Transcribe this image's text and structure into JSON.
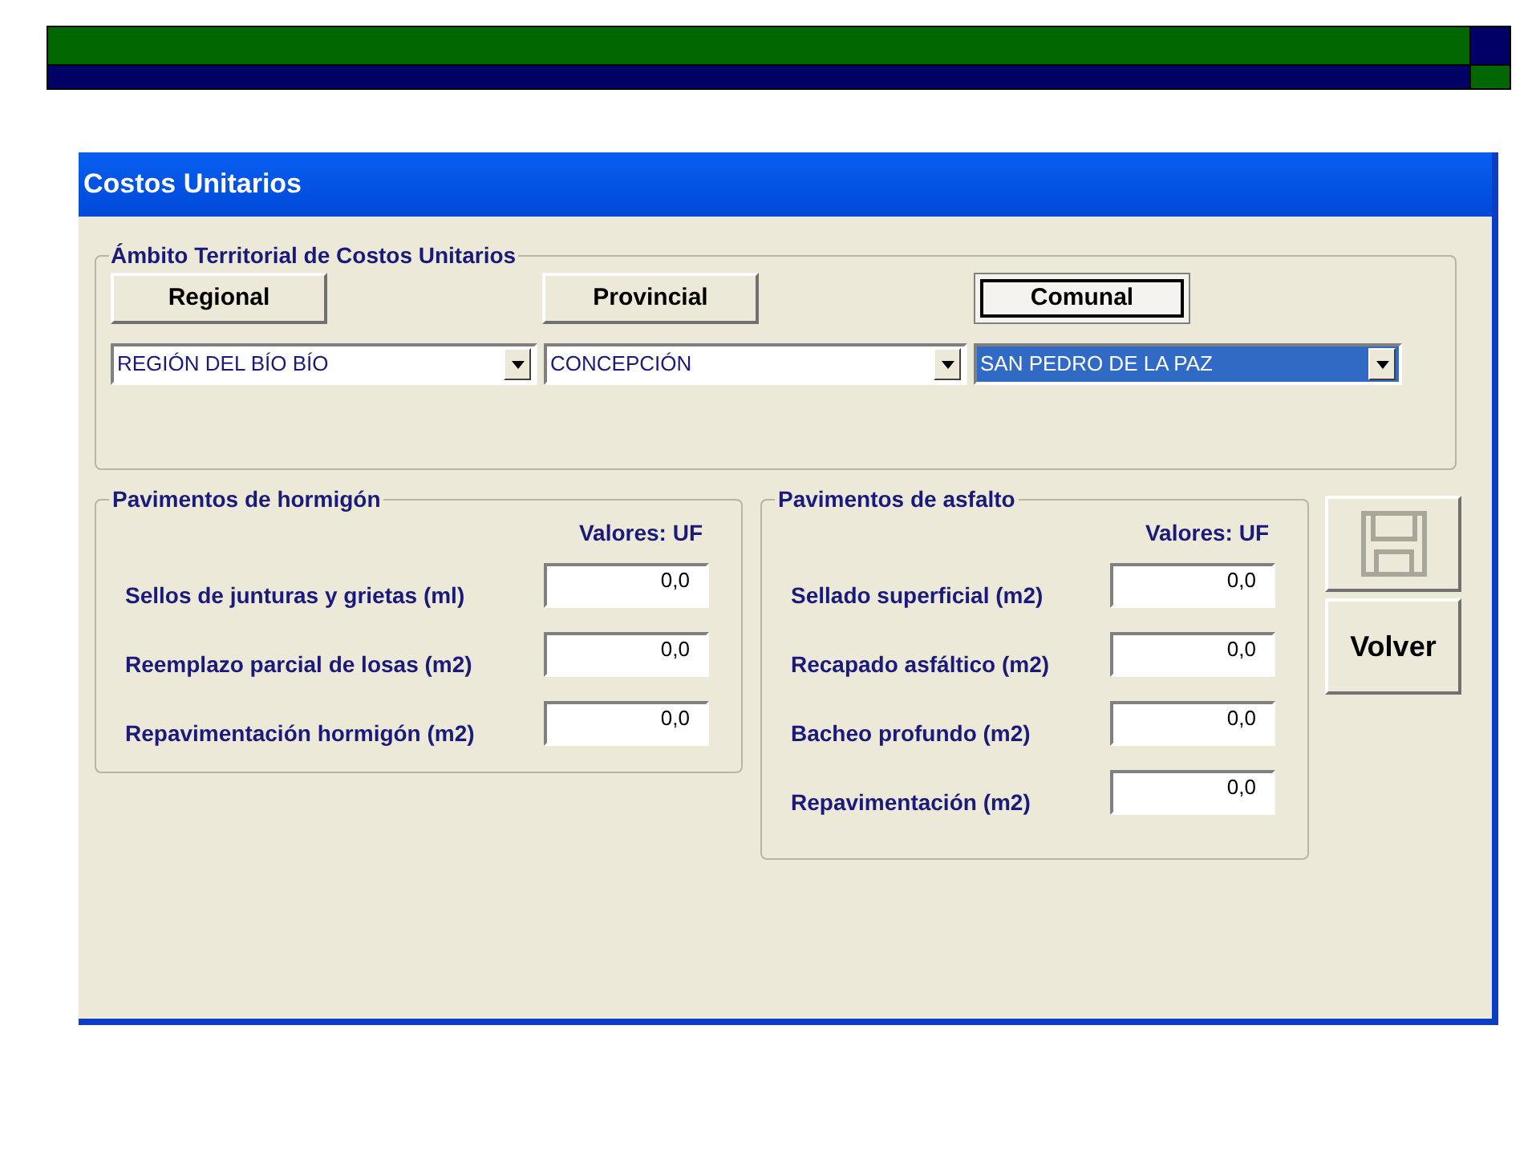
{
  "window": {
    "title": "Costos Unitarios"
  },
  "scope": {
    "legend": "Ámbito Territorial de Costos Unitarios",
    "buttons": [
      {
        "label": "Regional",
        "selected": false
      },
      {
        "label": "Provincial",
        "selected": false
      },
      {
        "label": "Comunal",
        "selected": true
      }
    ],
    "dropdowns": [
      {
        "value": "REGIÓN DEL BÍO BÍO",
        "focused": false
      },
      {
        "value": "CONCEPCIÓN",
        "focused": false
      },
      {
        "value": "SAN PEDRO DE LA PAZ",
        "focused": true
      }
    ]
  },
  "groups": [
    {
      "legend": "Pavimentos de hormigón",
      "header": "Valores: UF",
      "rows": [
        {
          "label": "Sellos de junturas y grietas (ml)",
          "value": "0,0"
        },
        {
          "label": "Reemplazo parcial de losas (m2)",
          "value": "0,0"
        },
        {
          "label": "Repavimentación hormigón (m2)",
          "value": "0,0"
        }
      ]
    },
    {
      "legend": "Pavimentos de asfalto",
      "header": "Valores: UF",
      "rows": [
        {
          "label": "Sellado superficial (m2)",
          "value": "0,0"
        },
        {
          "label": "Recapado asfáltico (m2)",
          "value": "0,0"
        },
        {
          "label": "Bacheo profundo (m2)",
          "value": "0,0"
        },
        {
          "label": "Repavimentación (m2)",
          "value": "0,0"
        }
      ]
    }
  ],
  "actions": [
    {
      "kind": "save",
      "disabled": true
    },
    {
      "kind": "text",
      "label": "Volver",
      "disabled": false
    }
  ]
}
